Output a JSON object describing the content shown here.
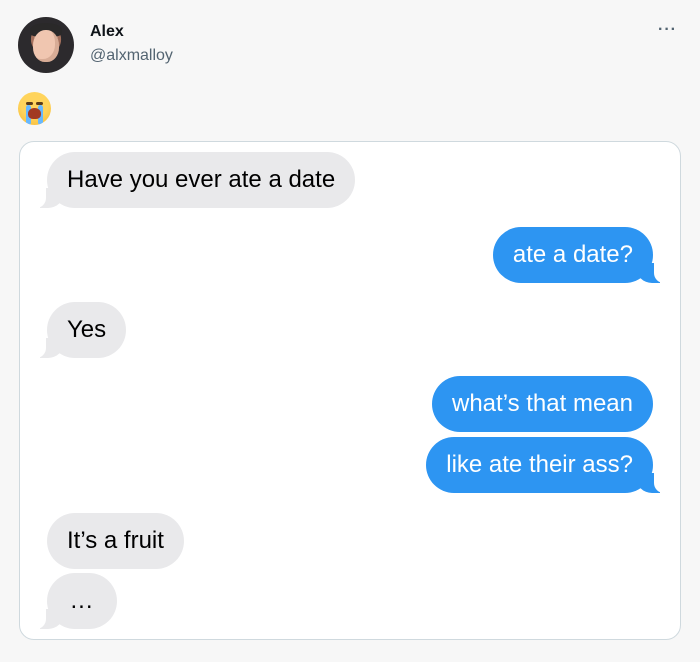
{
  "tweet": {
    "name": "Alex",
    "handle": "@alxmalloy",
    "more_label": "···",
    "emoji": "loudly-crying-face"
  },
  "conversation": [
    {
      "side": "received",
      "text": "Have you ever ate a date"
    },
    {
      "side": "sent",
      "text": "ate a date?"
    },
    {
      "side": "received",
      "text": "Yes"
    },
    {
      "side": "sent",
      "text": "what’s that mean"
    },
    {
      "side": "sent",
      "text": "like ate their ass?"
    },
    {
      "side": "received",
      "text": "It’s a fruit"
    },
    {
      "side": "received",
      "text": "..."
    }
  ],
  "colors": {
    "received_bubble": "#e9e9eb",
    "sent_bubble": "#2d95f2",
    "card_border": "#cfd9de"
  }
}
